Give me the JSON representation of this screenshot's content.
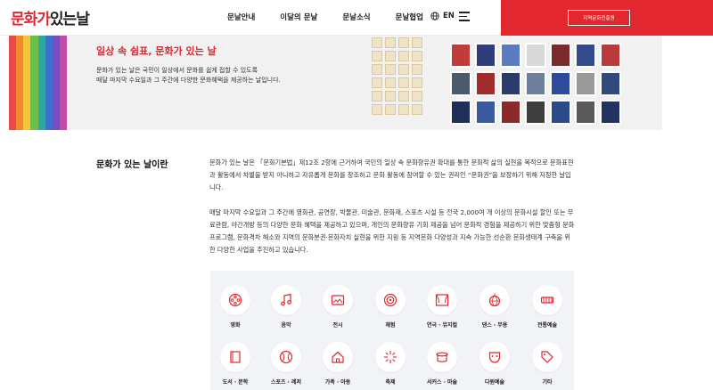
{
  "header": {
    "logo": {
      "part1": "문화가",
      "part2": "있는날"
    },
    "nav": [
      "문날안내",
      "이달의 문날",
      "문날소식",
      "문날협업"
    ],
    "lang": "EN",
    "region_button": "지역문화진흥원",
    "colors": {
      "brand": "#e2272e"
    }
  },
  "hero": {
    "title": "일상 속 쉼표, 문화가 있는 날",
    "desc_line1": "문화가 있는 날은 국민이 일상에서 문화를 쉽게 접할 수 있도록",
    "desc_line2": "매달 마지막 수요일과 그 주간에 다양한 문화혜택을 제공하는 날입니다."
  },
  "intro": {
    "title": "문화가 있는 날이란",
    "para1": "문화가 있는 날은 「문화기본법」제12조 2항에 근거하여 국민의 일상 속 문화향유권 확대를 통한 문화적 삶의 실현을 목적으로 문화표현과 활동에서 차별을 받지 아니하고 자유롭게 문화를 창조하고 문화 활동에 참여할 수 있는 권리인 “문화권”을 보장하기 위해 지정한 날입니다.",
    "para2": "매달 마지막 수요일과 그 주간에 영화관, 공연장, 박물관, 미술관, 문화재, 스포츠 시설 등 전국 2,000여 개 이상의 문화시설 할인 또는 무료관람, 야간개방 등의 다양한 문화 혜택을 제공하고 있으며, 개인의 문화향유 기회 제공을 넘어 문화적 경험을 제공하기 위한 맞춤형 문화프로그램, 문화격차 해소와 지역의 문화분권·문화자치 실현을 위한 지원 등 지역문화 다양성과 지속 가능한 선순환 문화생태계 구축을 위한 다양한 사업을 추진하고 있습니다."
  },
  "categories": [
    {
      "label": "영화",
      "icon": "film-reel-icon"
    },
    {
      "label": "음악",
      "icon": "music-note-icon"
    },
    {
      "label": "전시",
      "icon": "gallery-icon"
    },
    {
      "label": "체험",
      "icon": "target-icon"
    },
    {
      "label": "연극 · 뮤지컬",
      "icon": "theater-icon"
    },
    {
      "label": "댄스 · 무용",
      "icon": "disco-ball-icon"
    },
    {
      "label": "전통예술",
      "icon": "traditional-instrument-icon"
    },
    {
      "label": "도서 · 문학",
      "icon": "book-icon"
    },
    {
      "label": "스포츠 · 레저",
      "icon": "ball-icon"
    },
    {
      "label": "가족 · 아동",
      "icon": "home-icon"
    },
    {
      "label": "축제",
      "icon": "firework-icon"
    },
    {
      "label": "서커스 · 마술",
      "icon": "magic-hat-icon"
    },
    {
      "label": "다원예술",
      "icon": "mask-icon"
    },
    {
      "label": "기타",
      "icon": "tag-icon"
    }
  ]
}
